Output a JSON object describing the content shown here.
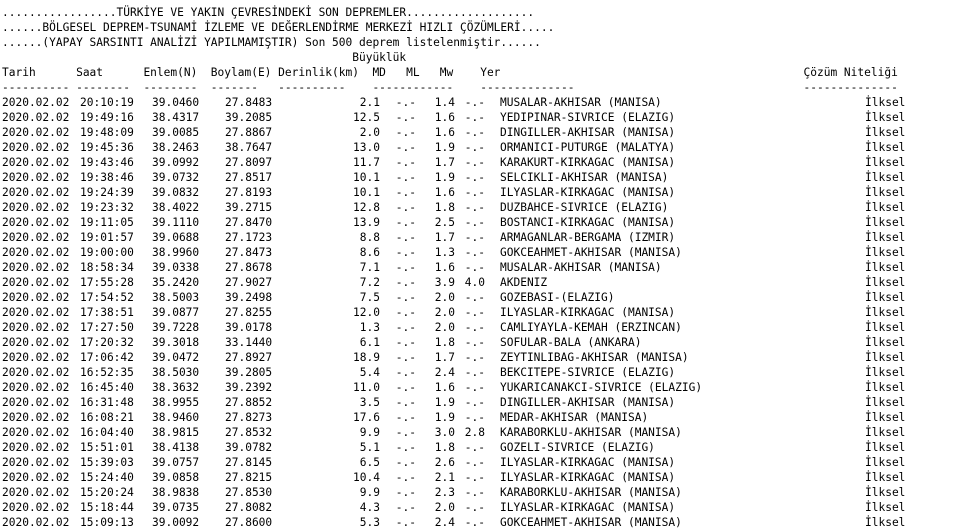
{
  "header": {
    "line1": ".................TÜRKİYE VE YAKIN ÇEVRESİNDEKİ SON DEPREMLER...................",
    "line2": "......BÖLGESEL DEPREM-TSUNAMİ İZLEME VE DEĞERLENDİRME MERKEZİ HIZLI ÇÖZÜMLERİ.....",
    "line3": "......(YAPAY SARSINTI ANALİZİ YAPILMAMIŞTIR) Son 500 deprem listelenmiştir......",
    "line4": "                                                    Büyüklük",
    "line5": "Tarih      Saat      Enlem(N)  Boylam(E) Derinlik(km)  MD   ML   Mw    Yer                                             Çözüm Niteliği",
    "line6": "---------- --------  --------  -------   ----------    ------------    --------------                                  --------------"
  },
  "rows": [
    {
      "date": "2020.02.02",
      "time": "20:10:19",
      "lat": "39.0460",
      "lon": "27.8483",
      "depth": "2.1",
      "md": "-.-",
      "ml": "1.4",
      "mw": "-.-",
      "place": "MUSALAR-AKHISAR (MANISA)",
      "quality": "İlksel"
    },
    {
      "date": "2020.02.02",
      "time": "19:49:16",
      "lat": "38.4317",
      "lon": "39.2085",
      "depth": "12.5",
      "md": "-.-",
      "ml": "1.6",
      "mw": "-.-",
      "place": "YEDIPINAR-SIVRICE (ELAZIG)",
      "quality": "İlksel"
    },
    {
      "date": "2020.02.02",
      "time": "19:48:09",
      "lat": "39.0085",
      "lon": "27.8867",
      "depth": "2.0",
      "md": "-.-",
      "ml": "1.6",
      "mw": "-.-",
      "place": "DINGILLER-AKHISAR (MANISA)",
      "quality": "İlksel"
    },
    {
      "date": "2020.02.02",
      "time": "19:45:36",
      "lat": "38.2463",
      "lon": "38.7647",
      "depth": "13.0",
      "md": "-.-",
      "ml": "1.9",
      "mw": "-.-",
      "place": "ORMANICI-PUTURGE (MALATYA)",
      "quality": "İlksel"
    },
    {
      "date": "2020.02.02",
      "time": "19:43:46",
      "lat": "39.0992",
      "lon": "27.8097",
      "depth": "11.7",
      "md": "-.-",
      "ml": "1.7",
      "mw": "-.-",
      "place": "KARAKURT-KIRKAGAC (MANISA)",
      "quality": "İlksel"
    },
    {
      "date": "2020.02.02",
      "time": "19:38:46",
      "lat": "39.0732",
      "lon": "27.8517",
      "depth": "10.1",
      "md": "-.-",
      "ml": "1.9",
      "mw": "-.-",
      "place": "SELCIKLI-AKHISAR (MANISA)",
      "quality": "İlksel"
    },
    {
      "date": "2020.02.02",
      "time": "19:24:39",
      "lat": "39.0832",
      "lon": "27.8193",
      "depth": "10.1",
      "md": "-.-",
      "ml": "1.6",
      "mw": "-.-",
      "place": "ILYASLAR-KIRKAGAC (MANISA)",
      "quality": "İlksel"
    },
    {
      "date": "2020.02.02",
      "time": "19:23:32",
      "lat": "38.4022",
      "lon": "39.2715",
      "depth": "12.8",
      "md": "-.-",
      "ml": "1.8",
      "mw": "-.-",
      "place": "DUZBAHCE-SIVRICE (ELAZIG)",
      "quality": "İlksel"
    },
    {
      "date": "2020.02.02",
      "time": "19:11:05",
      "lat": "39.1110",
      "lon": "27.8470",
      "depth": "13.9",
      "md": "-.-",
      "ml": "2.5",
      "mw": "-.-",
      "place": "BOSTANCI-KIRKAGAC (MANISA)",
      "quality": "İlksel"
    },
    {
      "date": "2020.02.02",
      "time": "19:01:57",
      "lat": "39.0688",
      "lon": "27.1723",
      "depth": "8.8",
      "md": "-.-",
      "ml": "1.7",
      "mw": "-.-",
      "place": "ARMAGANLAR-BERGAMA (IZMIR)",
      "quality": "İlksel"
    },
    {
      "date": "2020.02.02",
      "time": "19:00:00",
      "lat": "38.9960",
      "lon": "27.8473",
      "depth": "8.6",
      "md": "-.-",
      "ml": "1.3",
      "mw": "-.-",
      "place": "GOKCEAHMET-AKHISAR (MANISA)",
      "quality": "İlksel"
    },
    {
      "date": "2020.02.02",
      "time": "18:58:34",
      "lat": "39.0338",
      "lon": "27.8678",
      "depth": "7.1",
      "md": "-.-",
      "ml": "1.6",
      "mw": "-.-",
      "place": "MUSALAR-AKHISAR (MANISA)",
      "quality": "İlksel"
    },
    {
      "date": "2020.02.02",
      "time": "17:55:28",
      "lat": "35.2420",
      "lon": "27.9027",
      "depth": "7.2",
      "md": "-.-",
      "ml": "3.9",
      "mw": "4.0",
      "place": "AKDENIZ",
      "quality": "İlksel"
    },
    {
      "date": "2020.02.02",
      "time": "17:54:52",
      "lat": "38.5003",
      "lon": "39.2498",
      "depth": "7.5",
      "md": "-.-",
      "ml": "2.0",
      "mw": "-.-",
      "place": "GOZEBASI-(ELAZIG)",
      "quality": "İlksel"
    },
    {
      "date": "2020.02.02",
      "time": "17:38:51",
      "lat": "39.0877",
      "lon": "27.8255",
      "depth": "12.0",
      "md": "-.-",
      "ml": "2.0",
      "mw": "-.-",
      "place": "ILYASLAR-KIRKAGAC (MANISA)",
      "quality": "İlksel"
    },
    {
      "date": "2020.02.02",
      "time": "17:27:50",
      "lat": "39.7228",
      "lon": "39.0178",
      "depth": "1.3",
      "md": "-.-",
      "ml": "2.0",
      "mw": "-.-",
      "place": "CAMLIYAYLA-KEMAH (ERZINCAN)",
      "quality": "İlksel"
    },
    {
      "date": "2020.02.02",
      "time": "17:20:32",
      "lat": "39.3018",
      "lon": "33.1440",
      "depth": "6.1",
      "md": "-.-",
      "ml": "1.8",
      "mw": "-.-",
      "place": "SOFULAR-BALA (ANKARA)",
      "quality": "İlksel"
    },
    {
      "date": "2020.02.02",
      "time": "17:06:42",
      "lat": "39.0472",
      "lon": "27.8927",
      "depth": "18.9",
      "md": "-.-",
      "ml": "1.7",
      "mw": "-.-",
      "place": "ZEYTINLIBAG-AKHISAR (MANISA)",
      "quality": "İlksel"
    },
    {
      "date": "2020.02.02",
      "time": "16:52:35",
      "lat": "38.5030",
      "lon": "39.2805",
      "depth": "5.4",
      "md": "-.-",
      "ml": "2.4",
      "mw": "-.-",
      "place": "BEKCITEPE-SIVRICE (ELAZIG)",
      "quality": "İlksel"
    },
    {
      "date": "2020.02.02",
      "time": "16:45:40",
      "lat": "38.3632",
      "lon": "39.2392",
      "depth": "11.0",
      "md": "-.-",
      "ml": "1.6",
      "mw": "-.-",
      "place": "YUKARICANAKCI-SIVRICE (ELAZIG)",
      "quality": "İlksel"
    },
    {
      "date": "2020.02.02",
      "time": "16:31:48",
      "lat": "38.9955",
      "lon": "27.8852",
      "depth": "3.5",
      "md": "-.-",
      "ml": "1.9",
      "mw": "-.-",
      "place": "DINGILLER-AKHISAR (MANISA)",
      "quality": "İlksel"
    },
    {
      "date": "2020.02.02",
      "time": "16:08:21",
      "lat": "38.9460",
      "lon": "27.8273",
      "depth": "17.6",
      "md": "-.-",
      "ml": "1.9",
      "mw": "-.-",
      "place": "MEDAR-AKHISAR (MANISA)",
      "quality": "İlksel"
    },
    {
      "date": "2020.02.02",
      "time": "16:04:40",
      "lat": "38.9815",
      "lon": "27.8532",
      "depth": "9.9",
      "md": "-.-",
      "ml": "3.0",
      "mw": "2.8",
      "place": "KARABORKLU-AKHISAR (MANISA)",
      "quality": "İlksel"
    },
    {
      "date": "2020.02.02",
      "time": "15:51:01",
      "lat": "38.4138",
      "lon": "39.0782",
      "depth": "5.1",
      "md": "-.-",
      "ml": "1.8",
      "mw": "-.-",
      "place": "GOZELI-SIVRICE (ELAZIG)",
      "quality": "İlksel"
    },
    {
      "date": "2020.02.02",
      "time": "15:39:03",
      "lat": "39.0757",
      "lon": "27.8145",
      "depth": "6.5",
      "md": "-.-",
      "ml": "2.6",
      "mw": "-.-",
      "place": "ILYASLAR-KIRKAGAC (MANISA)",
      "quality": "İlksel"
    },
    {
      "date": "2020.02.02",
      "time": "15:24:40",
      "lat": "39.0858",
      "lon": "27.8215",
      "depth": "10.4",
      "md": "-.-",
      "ml": "2.1",
      "mw": "-.-",
      "place": "ILYASLAR-KIRKAGAC (MANISA)",
      "quality": "İlksel"
    },
    {
      "date": "2020.02.02",
      "time": "15:20:24",
      "lat": "38.9838",
      "lon": "27.8530",
      "depth": "9.9",
      "md": "-.-",
      "ml": "2.3",
      "mw": "-.-",
      "place": "KARABORKLU-AKHISAR (MANISA)",
      "quality": "İlksel"
    },
    {
      "date": "2020.02.02",
      "time": "15:18:44",
      "lat": "39.0735",
      "lon": "27.8082",
      "depth": "4.3",
      "md": "-.-",
      "ml": "2.0",
      "mw": "-.-",
      "place": "ILYASLAR-KIRKAGAC (MANISA)",
      "quality": "İlksel"
    },
    {
      "date": "2020.02.02",
      "time": "15:09:13",
      "lat": "39.0092",
      "lon": "27.8600",
      "depth": "5.3",
      "md": "-.-",
      "ml": "2.4",
      "mw": "-.-",
      "place": "GOKCEAHMET-AKHISAR (MANISA)",
      "quality": "İlksel"
    }
  ]
}
